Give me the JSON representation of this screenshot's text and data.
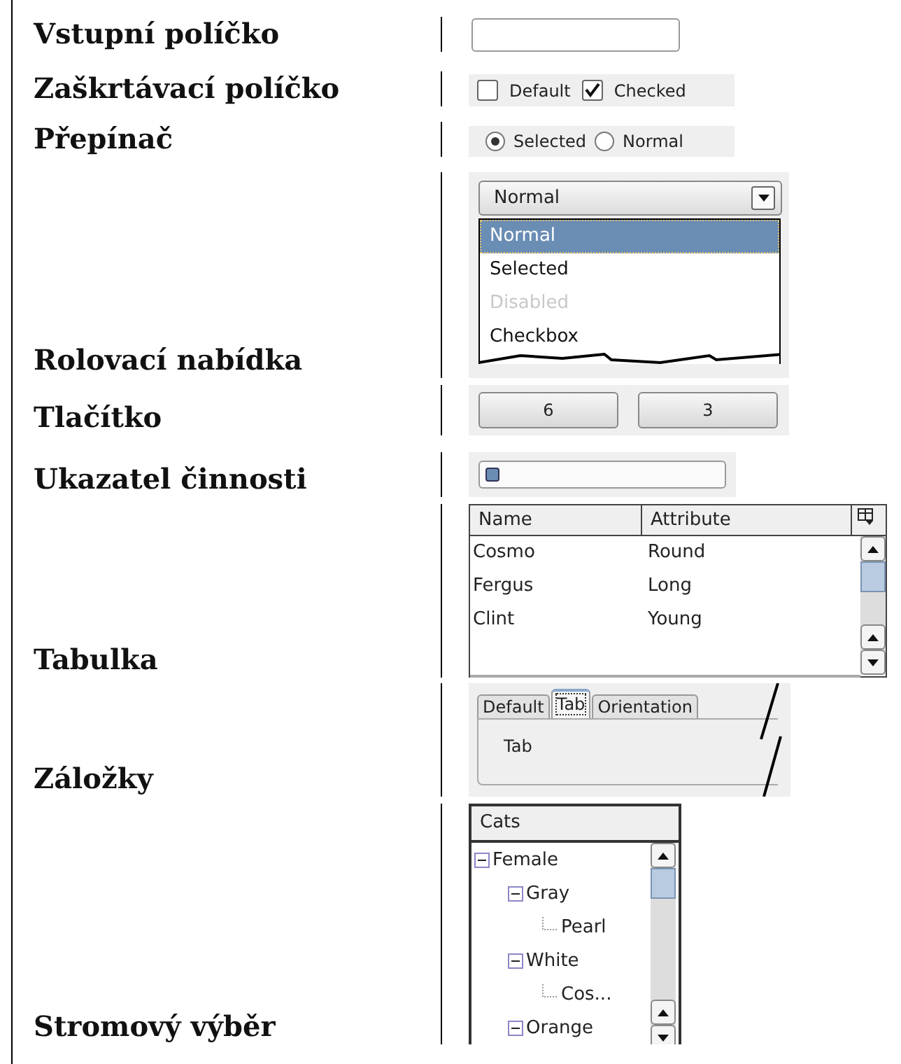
{
  "rows": [
    {
      "label": "Vstupní políčko",
      "widget": {
        "kind": "input"
      }
    },
    {
      "label": "Zaškrtávací políčko",
      "widget": {
        "kind": "checkboxes",
        "items": [
          {
            "label": "Default",
            "checked": false
          },
          {
            "label": "Checked",
            "checked": true
          }
        ]
      }
    },
    {
      "label": "Přepínač",
      "widget": {
        "kind": "radios",
        "items": [
          {
            "label": "Selected",
            "selected": true
          },
          {
            "label": "Normal",
            "selected": false
          }
        ]
      }
    },
    {
      "label": "Rolovací nabídka",
      "widget": {
        "kind": "dropdown",
        "value": "Normal",
        "options": [
          {
            "label": "Normal",
            "selected": true,
            "disabled": false
          },
          {
            "label": "Selected",
            "selected": false,
            "disabled": false
          },
          {
            "label": "Disabled",
            "selected": false,
            "disabled": true
          },
          {
            "label": "Checkbox",
            "selected": false,
            "disabled": false
          }
        ]
      }
    },
    {
      "label": "Tlačítko",
      "widget": {
        "kind": "buttons",
        "labels": [
          "6",
          "3"
        ]
      }
    },
    {
      "label": "Ukazatel činnosti",
      "widget": {
        "kind": "progress",
        "level": 0.06
      }
    },
    {
      "label": "Tabulka",
      "widget": {
        "kind": "table",
        "columns": [
          "Name",
          "Attribute"
        ],
        "rows": [
          [
            "Cosmo",
            "Round"
          ],
          [
            "Fergus",
            "Long"
          ],
          [
            "Clint",
            "Young"
          ]
        ]
      }
    },
    {
      "label": "Záložky",
      "widget": {
        "kind": "tabs",
        "tabs": [
          {
            "label": "Default",
            "selected": false
          },
          {
            "label": "Tab",
            "selected": true
          },
          {
            "label": "Orientation",
            "selected": false
          }
        ],
        "content": "Tab"
      }
    },
    {
      "label": "Stromový výběr",
      "widget": {
        "kind": "tree",
        "header": "Cats",
        "nodes": [
          {
            "label": "Female",
            "expanded": true,
            "children": [
              {
                "label": "Gray",
                "expanded": true,
                "children": [
                  {
                    "label": "Pearl"
                  }
                ]
              },
              {
                "label": "White",
                "expanded": true,
                "children": [
                  {
                    "label": "Cos..."
                  }
                ]
              },
              {
                "label": "Orange",
                "expanded": true
              }
            ]
          }
        ]
      }
    }
  ]
}
